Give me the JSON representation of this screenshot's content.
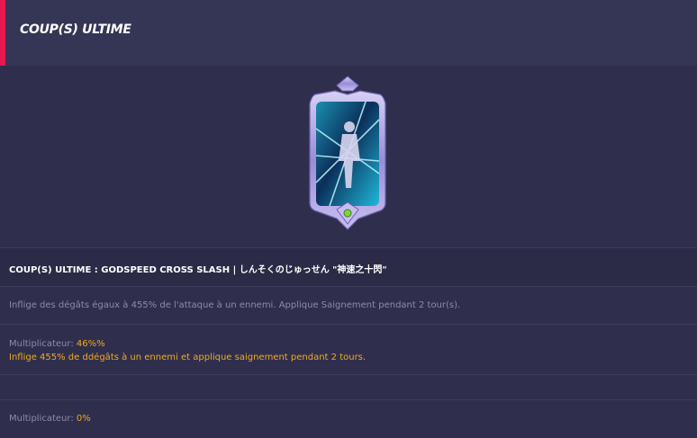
{
  "header": {
    "title": "COUP(S) ULTIME"
  },
  "skill": {
    "name": "COUP(S) ULTIME : GODSPEED CROSS SLASH | しんそくのじゅっせん \"神速之十閃\"",
    "description": "Inflige des dégâts égaux à 455% de l'attaque à un ennemi. Applique Saignement pendant 2 tour(s).",
    "multiplier_1": {
      "label": "Multiplicateur: ",
      "value": "46%%",
      "detail": "Inflige 455% de ddégâts à un ennemi et applique saignement pendant 2 tours."
    },
    "multiplier_2": {
      "label": "Multiplicateur: ",
      "value": "0%"
    }
  },
  "colors": {
    "accent": "#e8194f",
    "highlight": "#f0a820",
    "card_frame": "#a99be0"
  },
  "icons": {
    "card_gem": "gem-icon"
  }
}
